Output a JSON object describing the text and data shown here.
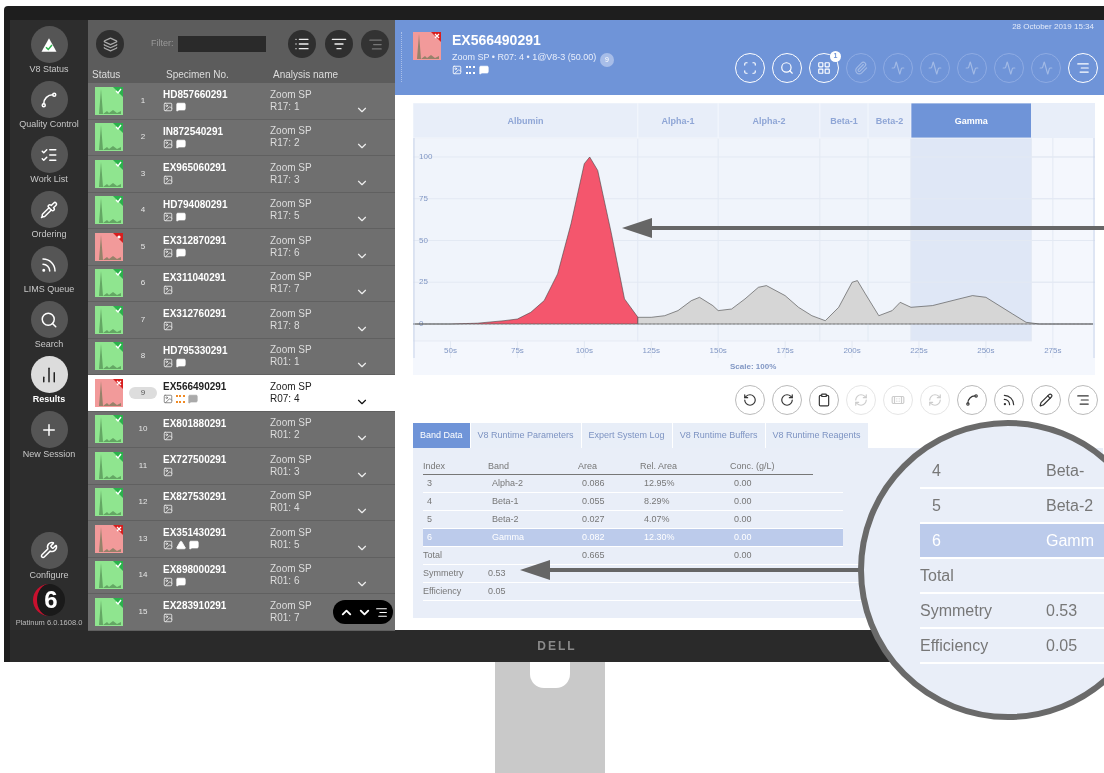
{
  "sidebar": {
    "items": [
      {
        "kind": "status",
        "label": "V8 Status",
        "selected": false
      },
      {
        "kind": "qc",
        "label": "Quality Control",
        "selected": false
      },
      {
        "kind": "worklist",
        "label": "Work List",
        "selected": false
      },
      {
        "kind": "ordering",
        "label": "Ordering",
        "selected": false
      },
      {
        "kind": "lims",
        "label": "LIMS Queue",
        "selected": false
      },
      {
        "kind": "search",
        "label": "Search",
        "selected": false
      },
      {
        "kind": "results",
        "label": "Results",
        "selected": true
      },
      {
        "kind": "new",
        "label": "New Session",
        "selected": false
      }
    ],
    "configure": {
      "label": "Configure"
    },
    "logo": {
      "text": "6"
    },
    "version": "Platinum 6.0.1608.0"
  },
  "list": {
    "filter": {
      "label": "Filter:"
    },
    "columns": [
      "Status",
      "Specimen No.",
      "Analysis name"
    ],
    "rows": [
      {
        "number": "1",
        "specimen": "HD857660291",
        "analysis": "Zoom SP",
        "run": "R17: 1",
        "kind": "passed",
        "icons": [
          {
            "kind": "image"
          },
          {
            "kind": "comment"
          }
        ],
        "selected": false
      },
      {
        "number": "2",
        "specimen": "IN872540291",
        "analysis": "Zoom SP",
        "run": "R17: 2",
        "kind": "passed",
        "icons": [
          {
            "kind": "image"
          },
          {
            "kind": "comment"
          }
        ],
        "selected": false
      },
      {
        "number": "3",
        "specimen": "EX965060291",
        "analysis": "Zoom SP",
        "run": "R17: 3",
        "kind": "passed",
        "icons": [
          {
            "kind": "image"
          }
        ],
        "selected": false
      },
      {
        "number": "4",
        "specimen": "HD794080291",
        "analysis": "Zoom SP",
        "run": "R17: 5",
        "kind": "passed",
        "icons": [
          {
            "kind": "image"
          },
          {
            "kind": "comment"
          }
        ],
        "selected": false
      },
      {
        "number": "5",
        "specimen": "EX312870291",
        "analysis": "Zoom SP",
        "run": "R17: 6",
        "kind": "flagged",
        "icons": [
          {
            "kind": "image"
          },
          {
            "kind": "comment"
          }
        ],
        "selected": false
      },
      {
        "number": "6",
        "specimen": "EX311040291",
        "analysis": "Zoom SP",
        "run": "R17: 7",
        "kind": "passed",
        "icons": [
          {
            "kind": "image"
          }
        ],
        "selected": false
      },
      {
        "number": "7",
        "specimen": "EX312760291",
        "analysis": "Zoom SP",
        "run": "R17: 8",
        "kind": "passed",
        "icons": [
          {
            "kind": "image"
          }
        ],
        "selected": false
      },
      {
        "number": "8",
        "specimen": "HD795330291",
        "analysis": "Zoom SP",
        "run": "R01: 1",
        "kind": "passed",
        "icons": [
          {
            "kind": "image"
          },
          {
            "kind": "comment"
          }
        ],
        "selected": false
      },
      {
        "number": "9",
        "specimen": "EX566490291",
        "analysis": "Zoom SP",
        "run": "R07: 4",
        "kind": "failed",
        "icons": [
          {
            "kind": "image"
          },
          {
            "kind": "alert"
          },
          {
            "kind": "comment"
          }
        ],
        "selected": true
      },
      {
        "number": "10",
        "specimen": "EX801880291",
        "analysis": "Zoom SP",
        "run": "R01: 2",
        "kind": "passed",
        "icons": [
          {
            "kind": "image"
          }
        ],
        "selected": false
      },
      {
        "number": "11",
        "specimen": "EX727500291",
        "analysis": "Zoom SP",
        "run": "R01: 3",
        "kind": "passed",
        "icons": [
          {
            "kind": "image"
          }
        ],
        "selected": false
      },
      {
        "number": "12",
        "specimen": "EX827530291",
        "analysis": "Zoom SP",
        "run": "R01: 4",
        "kind": "passed",
        "icons": [
          {
            "kind": "image"
          }
        ],
        "selected": false
      },
      {
        "number": "13",
        "specimen": "EX351430291",
        "analysis": "Zoom SP",
        "run": "R01: 5",
        "kind": "failed",
        "icons": [
          {
            "kind": "image"
          },
          {
            "kind": "warning"
          },
          {
            "kind": "comment"
          }
        ],
        "selected": false
      },
      {
        "number": "14",
        "specimen": "EX898000291",
        "analysis": "Zoom SP",
        "run": "R01: 6",
        "kind": "passed",
        "icons": [
          {
            "kind": "image"
          },
          {
            "kind": "comment"
          }
        ],
        "selected": false
      },
      {
        "number": "15",
        "specimen": "EX283910291",
        "analysis": "Zoom SP",
        "run": "R01: 7",
        "kind": "passed",
        "icons": [
          {
            "kind": "image"
          }
        ],
        "selected": false
      }
    ]
  },
  "header": {
    "date": "28 October 2019 15:34",
    "title": "EX566490291",
    "subtitle": "Zoom SP • R07: 4 • 1@V8-3 (50.00)",
    "kind": "failed",
    "count": "9",
    "tools": [
      {
        "kind": "frame",
        "disabled": false
      },
      {
        "kind": "search",
        "disabled": false
      },
      {
        "kind": "grid",
        "disabled": false,
        "badge": "1"
      },
      {
        "kind": "paperclip",
        "disabled": true
      },
      {
        "kind": "wave",
        "disabled": true
      },
      {
        "kind": "wave",
        "disabled": true
      },
      {
        "kind": "wave",
        "disabled": true
      },
      {
        "kind": "wave",
        "disabled": true
      },
      {
        "kind": "wave",
        "disabled": true
      },
      {
        "kind": "menu",
        "disabled": false
      }
    ]
  },
  "chart": {
    "scale": "Scale: 100%",
    "chart_data": {
      "type": "area",
      "xlim": [
        36,
        290
      ],
      "ylim": [
        0,
        100
      ],
      "grid": true,
      "xticks": [
        {
          "value": 50,
          "label": "50s"
        },
        {
          "value": 75,
          "label": "75s"
        },
        {
          "value": 100,
          "label": "100s"
        },
        {
          "value": 125,
          "label": "125s"
        },
        {
          "value": 150,
          "label": "150s"
        },
        {
          "value": 175,
          "label": "175s"
        },
        {
          "value": 200,
          "label": "200s"
        },
        {
          "value": 225,
          "label": "225s"
        },
        {
          "value": 250,
          "label": "250s"
        },
        {
          "value": 275,
          "label": "275s"
        }
      ],
      "yticks": [
        0,
        25,
        50,
        75,
        100
      ],
      "x": [
        36,
        50,
        60,
        70,
        75,
        80,
        85,
        90,
        95,
        100,
        102,
        105,
        110,
        115,
        120,
        125,
        130,
        135,
        140,
        143,
        148,
        150,
        155,
        160,
        165,
        168,
        175,
        180,
        185,
        190,
        195,
        200,
        202,
        205,
        210,
        215,
        218,
        222,
        230,
        240,
        245,
        250,
        260,
        265,
        270,
        290
      ],
      "series": [
        {
          "color": "#f4566d",
          "values": [
            0,
            0,
            0.5,
            2,
            3,
            7,
            14,
            30,
            60,
            96,
            100,
            92,
            55,
            15,
            4,
            null,
            null,
            null,
            null,
            null,
            null,
            null,
            null,
            null,
            null,
            null,
            null,
            null,
            null,
            null,
            null,
            null,
            null,
            null,
            null,
            null,
            null,
            null,
            null,
            null,
            null,
            null,
            null,
            null,
            null,
            null
          ]
        },
        {
          "color": "#d6d6d6",
          "values": [
            null,
            null,
            null,
            null,
            null,
            null,
            null,
            null,
            null,
            null,
            null,
            null,
            null,
            null,
            4,
            4,
            5,
            8,
            14,
            16,
            11,
            8,
            9,
            15,
            22,
            23,
            17,
            10,
            5,
            2,
            10,
            25,
            26,
            18,
            5,
            8,
            13,
            10,
            11,
            15,
            17,
            16,
            6,
            1,
            0,
            0
          ]
        }
      ],
      "bands": [
        {
          "axis": "x",
          "label": "Albumin",
          "from": 36,
          "to": 120
        },
        {
          "axis": "x",
          "label": "Alpha-1",
          "from": 120,
          "to": 150
        },
        {
          "axis": "x",
          "label": "Alpha-2",
          "from": 150,
          "to": 188
        },
        {
          "axis": "x",
          "label": "Beta-1",
          "from": 188,
          "to": 206
        },
        {
          "axis": "x",
          "label": "Beta-2",
          "from": 206,
          "to": 222
        },
        {
          "axis": "x",
          "label": "Gamma",
          "from": 222,
          "to": 267
        }
      ]
    },
    "band_headers": [
      {
        "selected": false
      },
      {
        "selected": false
      },
      {
        "selected": false
      },
      {
        "selected": false
      },
      {
        "selected": false
      },
      {
        "selected": true
      }
    ]
  },
  "chart_tools": [
    {
      "kind": "undo",
      "disabled": false
    },
    {
      "kind": "redo",
      "disabled": false
    },
    {
      "kind": "clipboard",
      "disabled": false
    },
    {
      "kind": "refresh",
      "disabled": true
    },
    {
      "kind": "bandage",
      "disabled": true
    },
    {
      "kind": "refresh",
      "disabled": true
    },
    {
      "kind": "spline",
      "disabled": false
    },
    {
      "kind": "feed",
      "disabled": false
    },
    {
      "kind": "pencil",
      "disabled": false
    },
    {
      "kind": "menu",
      "disabled": false
    }
  ],
  "tabs": [
    {
      "label": "Band Data",
      "selected": true
    },
    {
      "label": "V8 Runtime Parameters",
      "selected": false
    },
    {
      "label": "Expert System Log",
      "selected": false
    },
    {
      "label": "V8 Runtime Buffers",
      "selected": false
    },
    {
      "label": "V8 Runtime Reagents",
      "selected": false
    }
  ],
  "band_table": {
    "columns": [
      "Index",
      "Band",
      "Area",
      "Rel. Area",
      "Conc. (g/L)"
    ],
    "rows": [
      {
        "cells": [
          "3",
          "Alpha-2",
          "0.086",
          "12.95%",
          "0.00"
        ],
        "selected": false
      },
      {
        "cells": [
          "4",
          "Beta-1",
          "0.055",
          "8.29%",
          "0.00"
        ],
        "selected": false
      },
      {
        "cells": [
          "5",
          "Beta-2",
          "0.027",
          "4.07%",
          "0.00"
        ],
        "selected": false
      },
      {
        "cells": [
          "6",
          "Gamma",
          "0.082",
          "12.30%",
          "0.00"
        ],
        "selected": true
      }
    ],
    "total": {
      "label": "Total",
      "area": "0.665",
      "conc": "0.00"
    },
    "stats": [
      {
        "label": "Symmetry",
        "value": "0.53"
      },
      {
        "label": "Efficiency",
        "value": "0.05"
      }
    ]
  },
  "magnifier": {
    "rows": [
      {
        "cells": [
          "4",
          "Beta-"
        ],
        "selected": false
      },
      {
        "cells": [
          "5",
          "Beta-2"
        ],
        "selected": false
      },
      {
        "cells": [
          "6",
          "Gamm"
        ],
        "selected": true
      },
      {
        "cells": [
          "Total"
        ],
        "selected": false
      },
      {
        "cells": [
          "Symmetry",
          "0.53"
        ],
        "selected": false
      },
      {
        "cells": [
          "Efficiency",
          "0.05"
        ],
        "selected": false
      }
    ]
  },
  "monitor": {
    "brand": "DELL"
  }
}
